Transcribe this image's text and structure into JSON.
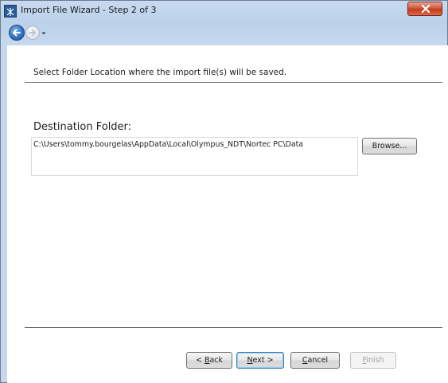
{
  "window": {
    "title": "Import File Wizard - Step 2 of 3"
  },
  "nav": {
    "back_icon": "back-arrow-icon",
    "forward_icon": "forward-arrow-icon",
    "dropdown_icon": "chevron-down-icon"
  },
  "wizard": {
    "instruction": "Select Folder Location where the import file(s) will be saved.",
    "destination_label": "Destination Folder:",
    "destination_path": "C:\\Users\\tommy.bourgelas\\AppData\\Local\\Olympus_NDT\\Nortec PC\\Data",
    "browse_label": "Browse..."
  },
  "buttons": {
    "back_mnemonic": "B",
    "back_rest": "ack",
    "back_prefix": "< ",
    "next_mnemonic": "N",
    "next_rest": "ext",
    "next_suffix": " >",
    "cancel_mnemonic": "C",
    "cancel_rest": "ancel",
    "finish_mnemonic": "F",
    "finish_rest": "inish"
  },
  "colors": {
    "titlebar": "#bcd2ea",
    "close_button": "#c23a1d",
    "default_button_border": "#3c7fb1"
  }
}
